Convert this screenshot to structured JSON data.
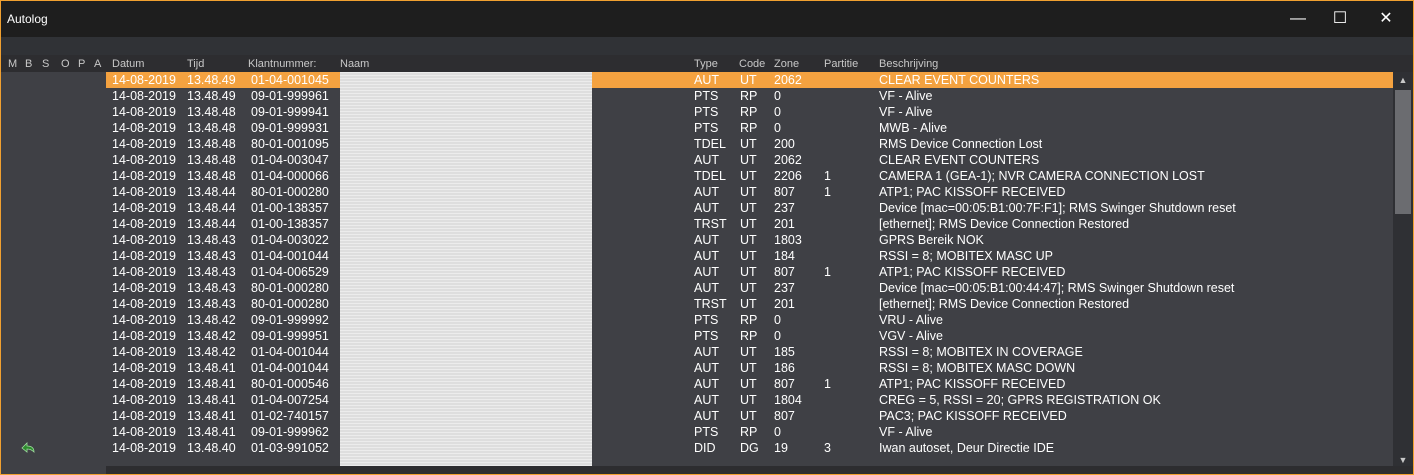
{
  "window": {
    "title": "Autolog",
    "minimize_glyph": "—",
    "maximize_glyph": "☐",
    "close_glyph": "✕"
  },
  "columns": {
    "flags": [
      "M",
      "B",
      "S",
      "O",
      "P",
      "A"
    ],
    "datum": "Datum",
    "tijd": "Tijd",
    "klantnummer": "Klantnummer:",
    "naam": "Naam",
    "type": "Type",
    "code": "Code",
    "zone": "Zone",
    "partitie": "Partitie",
    "beschrijving": "Beschrijving"
  },
  "rows": [
    {
      "datum": "14-08-2019",
      "tijd": "13.48.49",
      "klant": "01-04-001045",
      "type": "AUT",
      "code": "UT",
      "zone": "2062",
      "partitie": "",
      "beschrijving": "CLEAR EVENT COUNTERS",
      "selected": true
    },
    {
      "datum": "14-08-2019",
      "tijd": "13.48.49",
      "klant": "09-01-999961",
      "type": "PTS",
      "code": "RP",
      "zone": "0",
      "partitie": "",
      "beschrijving": "VF - Alive"
    },
    {
      "datum": "14-08-2019",
      "tijd": "13.48.48",
      "klant": "09-01-999941",
      "type": "PTS",
      "code": "RP",
      "zone": "0",
      "partitie": "",
      "beschrijving": "VF - Alive"
    },
    {
      "datum": "14-08-2019",
      "tijd": "13.48.48",
      "klant": "09-01-999931",
      "type": "PTS",
      "code": "RP",
      "zone": "0",
      "partitie": "",
      "beschrijving": "MWB - Alive"
    },
    {
      "datum": "14-08-2019",
      "tijd": "13.48.48",
      "klant": "80-01-001095",
      "type": "TDEL",
      "code": "UT",
      "zone": "200",
      "partitie": "",
      "beschrijving": "RMS Device Connection Lost"
    },
    {
      "datum": "14-08-2019",
      "tijd": "13.48.48",
      "klant": "01-04-003047",
      "type": "AUT",
      "code": "UT",
      "zone": "2062",
      "partitie": "",
      "beschrijving": "CLEAR EVENT COUNTERS"
    },
    {
      "datum": "14-08-2019",
      "tijd": "13.48.48",
      "klant": "01-04-000066",
      "type": "TDEL",
      "code": "UT",
      "zone": "2206",
      "partitie": "1",
      "beschrijving": "CAMERA 1 (GEA-1); NVR CAMERA CONNECTION LOST"
    },
    {
      "datum": "14-08-2019",
      "tijd": "13.48.44",
      "klant": "80-01-000280",
      "type": "AUT",
      "code": "UT",
      "zone": "807",
      "partitie": "1",
      "beschrijving": "ATP1; PAC KISSOFF RECEIVED"
    },
    {
      "datum": "14-08-2019",
      "tijd": "13.48.44",
      "klant": "01-00-138357",
      "type": "AUT",
      "code": "UT",
      "zone": "237",
      "partitie": "",
      "beschrijving": "Device [mac=00:05:B1:00:7F:F1]; RMS Swinger Shutdown reset"
    },
    {
      "datum": "14-08-2019",
      "tijd": "13.48.44",
      "klant": "01-00-138357",
      "type": "TRST",
      "code": "UT",
      "zone": "201",
      "partitie": "",
      "beschrijving": " [ethernet]; RMS Device Connection Restored"
    },
    {
      "datum": "14-08-2019",
      "tijd": "13.48.43",
      "klant": "01-04-003022",
      "type": "AUT",
      "code": "UT",
      "zone": "1803",
      "partitie": "",
      "beschrijving": "GPRS Bereik NOK"
    },
    {
      "datum": "14-08-2019",
      "tijd": "13.48.43",
      "klant": "01-04-001044",
      "type": "AUT",
      "code": "UT",
      "zone": "184",
      "partitie": "",
      "beschrijving": "RSSI = 8; MOBITEX MASC UP"
    },
    {
      "datum": "14-08-2019",
      "tijd": "13.48.43",
      "klant": "01-04-006529",
      "type": "AUT",
      "code": "UT",
      "zone": "807",
      "partitie": "1",
      "beschrijving": "ATP1; PAC KISSOFF RECEIVED"
    },
    {
      "datum": "14-08-2019",
      "tijd": "13.48.43",
      "klant": "80-01-000280",
      "type": "AUT",
      "code": "UT",
      "zone": "237",
      "partitie": "",
      "beschrijving": "Device [mac=00:05:B1:00:44:47]; RMS Swinger Shutdown reset"
    },
    {
      "datum": "14-08-2019",
      "tijd": "13.48.43",
      "klant": "80-01-000280",
      "type": "TRST",
      "code": "UT",
      "zone": "201",
      "partitie": "",
      "beschrijving": " [ethernet]; RMS Device Connection Restored"
    },
    {
      "datum": "14-08-2019",
      "tijd": "13.48.42",
      "klant": "09-01-999992",
      "type": "PTS",
      "code": "RP",
      "zone": "0",
      "partitie": "",
      "beschrijving": "VRU - Alive"
    },
    {
      "datum": "14-08-2019",
      "tijd": "13.48.42",
      "klant": "09-01-999951",
      "type": "PTS",
      "code": "RP",
      "zone": "0",
      "partitie": "",
      "beschrijving": "VGV - Alive"
    },
    {
      "datum": "14-08-2019",
      "tijd": "13.48.42",
      "klant": "01-04-001044",
      "type": "AUT",
      "code": "UT",
      "zone": "185",
      "partitie": "",
      "beschrijving": "RSSI = 8; MOBITEX IN COVERAGE"
    },
    {
      "datum": "14-08-2019",
      "tijd": "13.48.41",
      "klant": "01-04-001044",
      "type": "AUT",
      "code": "UT",
      "zone": "186",
      "partitie": "",
      "beschrijving": "RSSI = 8; MOBITEX MASC DOWN"
    },
    {
      "datum": "14-08-2019",
      "tijd": "13.48.41",
      "klant": "80-01-000546",
      "type": "AUT",
      "code": "UT",
      "zone": "807",
      "partitie": "1",
      "beschrijving": "ATP1; PAC KISSOFF RECEIVED"
    },
    {
      "datum": "14-08-2019",
      "tijd": "13.48.41",
      "klant": "01-04-007254",
      "type": "AUT",
      "code": "UT",
      "zone": "1804",
      "partitie": "",
      "beschrijving": "CREG = 5, RSSI = 20; GPRS REGISTRATION OK"
    },
    {
      "datum": "14-08-2019",
      "tijd": "13.48.41",
      "klant": "01-02-740157",
      "type": "AUT",
      "code": "UT",
      "zone": "807",
      "partitie": "",
      "beschrijving": "PAC3; PAC KISSOFF RECEIVED"
    },
    {
      "datum": "14-08-2019",
      "tijd": "13.48.41",
      "klant": "09-01-999962",
      "type": "PTS",
      "code": "RP",
      "zone": "0",
      "partitie": "",
      "beschrijving": "VF - Alive"
    },
    {
      "datum": "14-08-2019",
      "tijd": "13.48.40",
      "klant": "01-03-991052",
      "type": "DID",
      "code": "DG",
      "zone": "19",
      "partitie": "3",
      "beschrijving": "Iwan autoset, Deur Directie IDE"
    }
  ],
  "scrollbar": {
    "up_glyph": "▲",
    "down_glyph": "▼"
  },
  "colors": {
    "accent": "#f4a240",
    "titlebar": "#1e1e1e",
    "grid_bg": "#3f4045",
    "undo_icon": "#2e8b2e"
  },
  "icons": {
    "undo": "undo-arrow-icon"
  }
}
